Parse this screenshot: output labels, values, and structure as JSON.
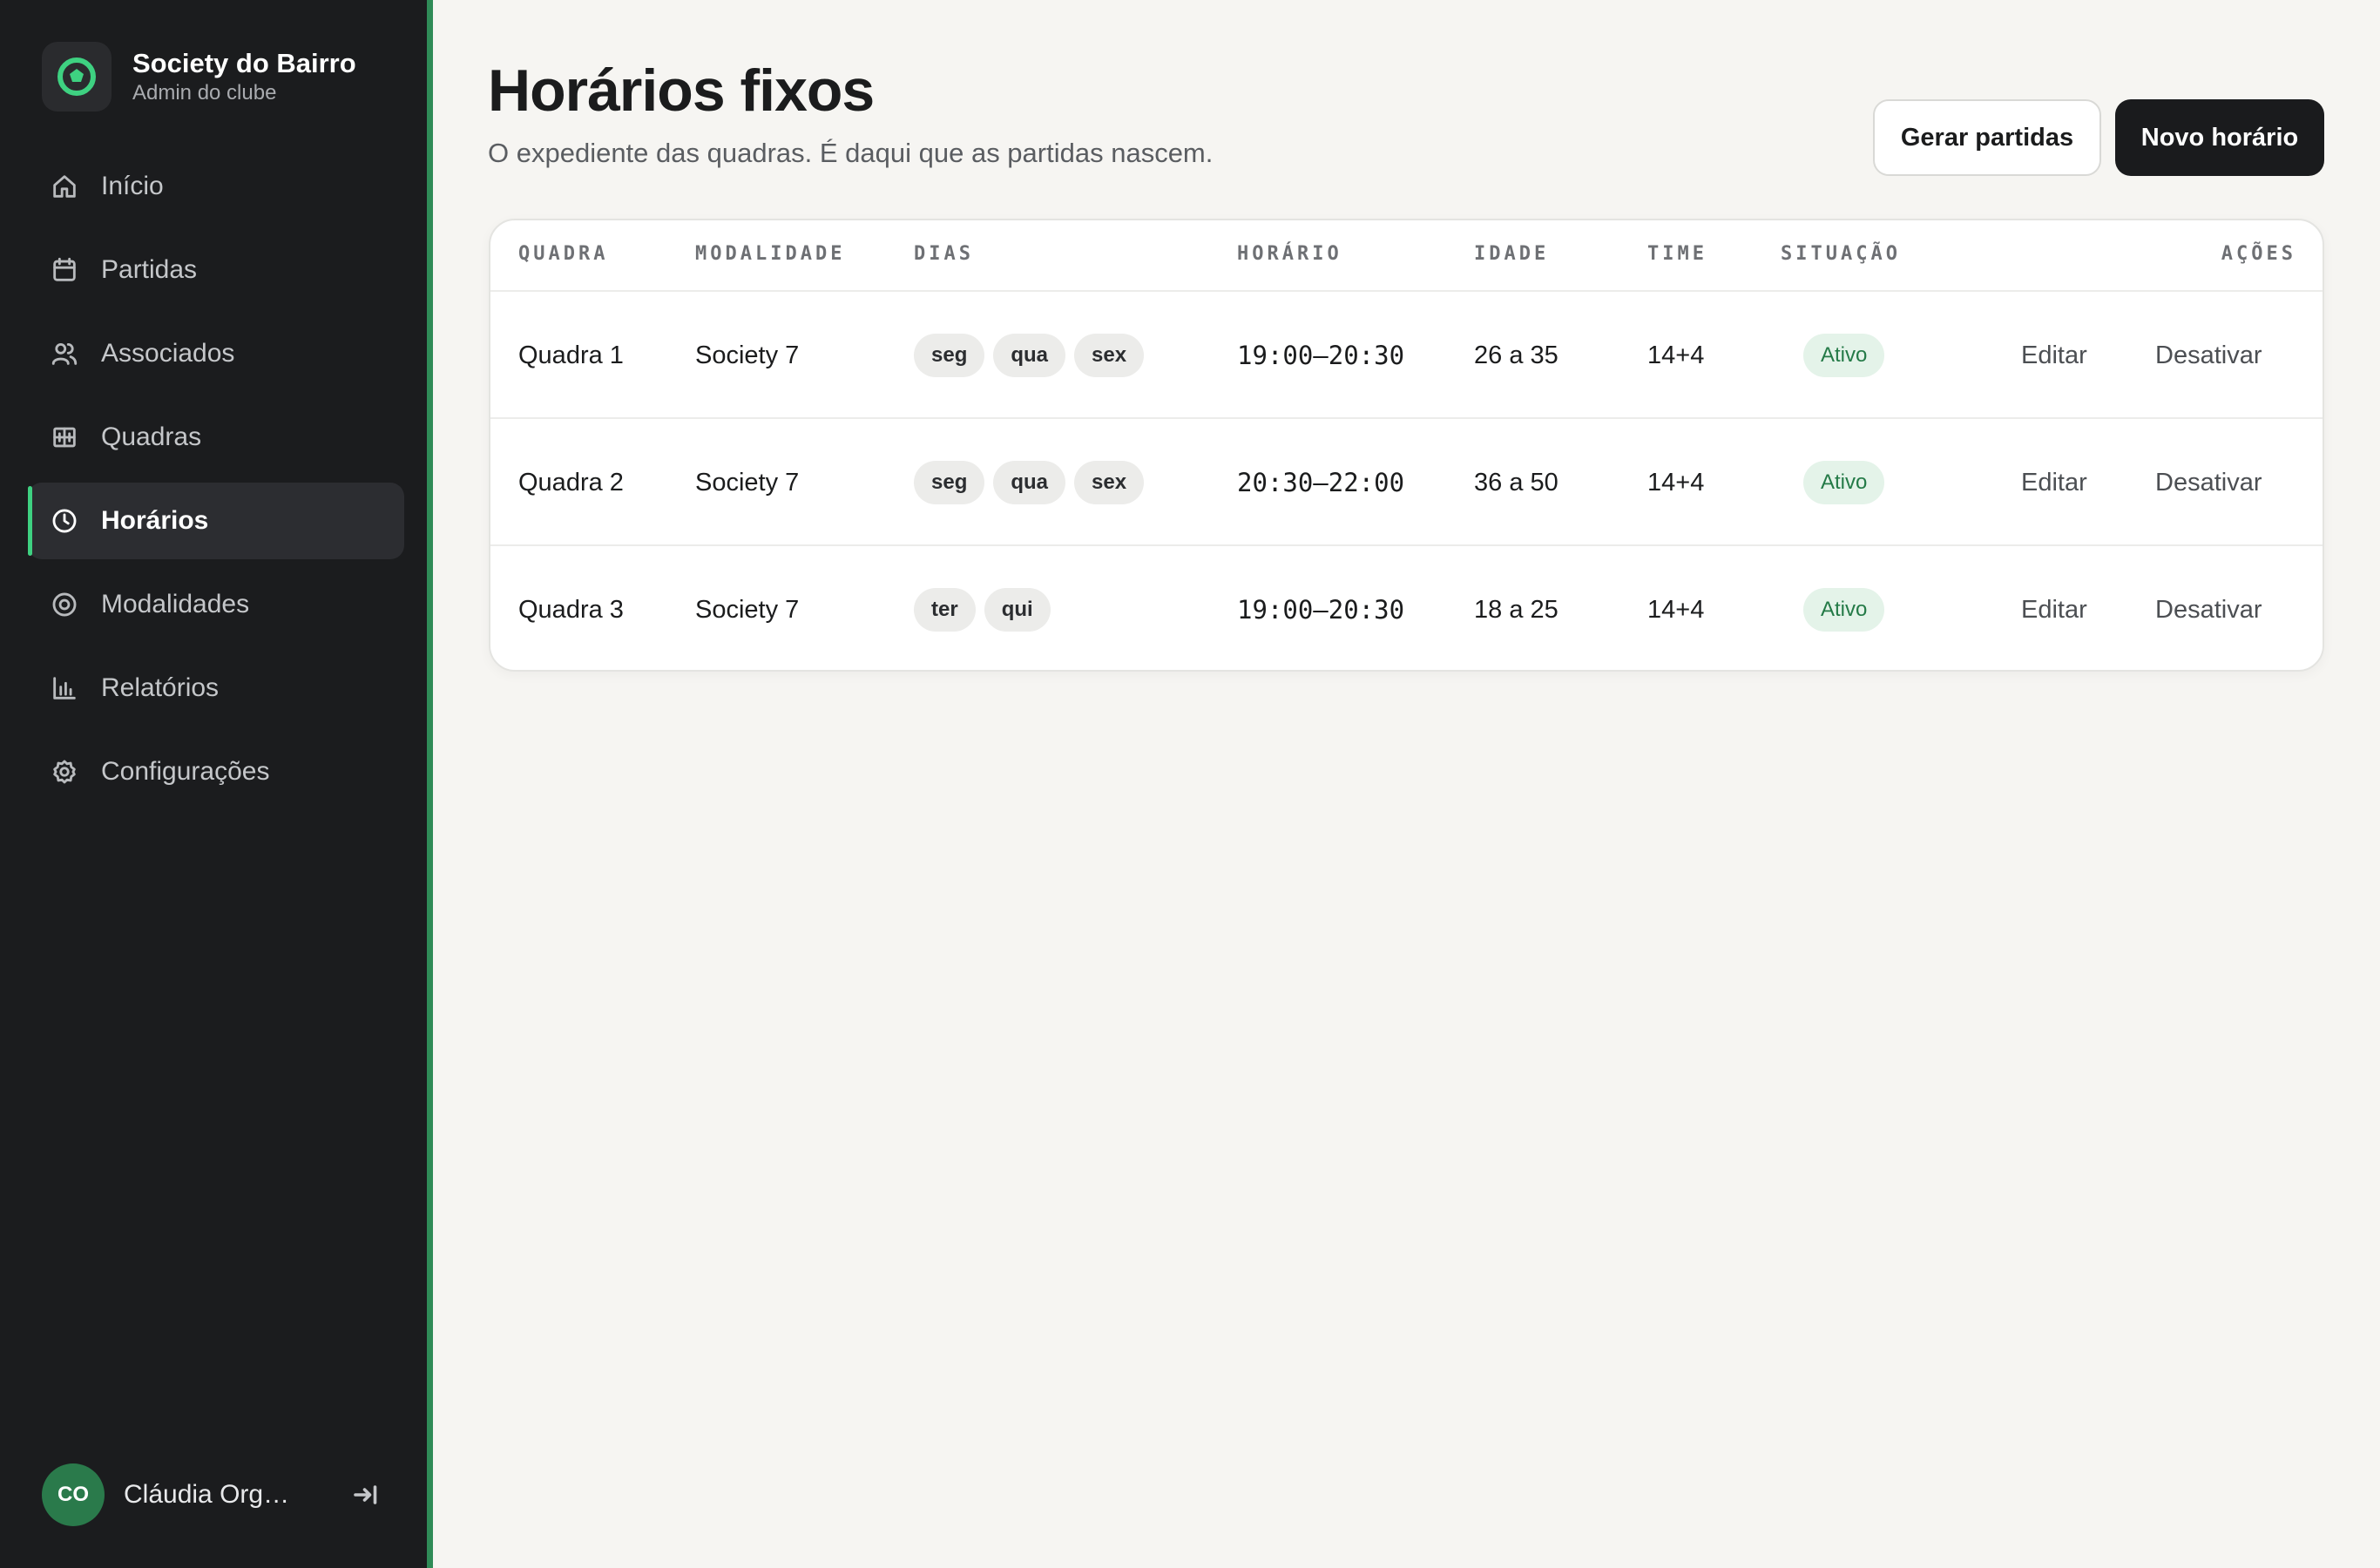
{
  "brand": {
    "title": "Society do Bairro",
    "subtitle": "Admin do clube",
    "logo_icon": "pentagon-badge-icon",
    "accent": "#2f8b57"
  },
  "sidebar": {
    "items": [
      {
        "label": "Início",
        "icon": "home-icon"
      },
      {
        "label": "Partidas",
        "icon": "calendar-icon"
      },
      {
        "label": "Associados",
        "icon": "users-icon"
      },
      {
        "label": "Quadras",
        "icon": "grid-icon"
      },
      {
        "label": "Horários",
        "icon": "clock-icon",
        "active": true
      },
      {
        "label": "Modalidades",
        "icon": "target-icon"
      },
      {
        "label": "Relatórios",
        "icon": "bar-chart-icon"
      },
      {
        "label": "Configurações",
        "icon": "gear-icon"
      }
    ]
  },
  "user": {
    "initials": "CO",
    "name": "Cláudia Org…",
    "logout_icon": "logout-icon"
  },
  "header": {
    "title": "Horários fixos",
    "subtitle": "O expediente das quadras. É daqui que as partidas nascem.",
    "secondary_button": "Gerar partidas",
    "primary_button": "Novo horário"
  },
  "table": {
    "columns": [
      "QUADRA",
      "MODALIDADE",
      "DIAS",
      "HORÁRIO",
      "IDADE",
      "TIME",
      "SITUAÇÃO",
      "AÇÕES"
    ],
    "rows": [
      {
        "quadra": "Quadra 1",
        "modalidade": "Society 7",
        "dias": [
          "seg",
          "qua",
          "sex"
        ],
        "horario": "19:00–20:30",
        "idade": "26 a 35",
        "time": "14+4",
        "situacao": "Ativo",
        "edit": "Editar",
        "deactivate": "Desativar"
      },
      {
        "quadra": "Quadra 2",
        "modalidade": "Society 7",
        "dias": [
          "seg",
          "qua",
          "sex"
        ],
        "horario": "20:30–22:00",
        "idade": "36 a 50",
        "time": "14+4",
        "situacao": "Ativo",
        "edit": "Editar",
        "deactivate": "Desativar"
      },
      {
        "quadra": "Quadra 3",
        "modalidade": "Society 7",
        "dias": [
          "ter",
          "qui"
        ],
        "horario": "19:00–20:30",
        "idade": "18 a 25",
        "time": "14+4",
        "situacao": "Ativo",
        "edit": "Editar",
        "deactivate": "Desativar"
      }
    ]
  }
}
